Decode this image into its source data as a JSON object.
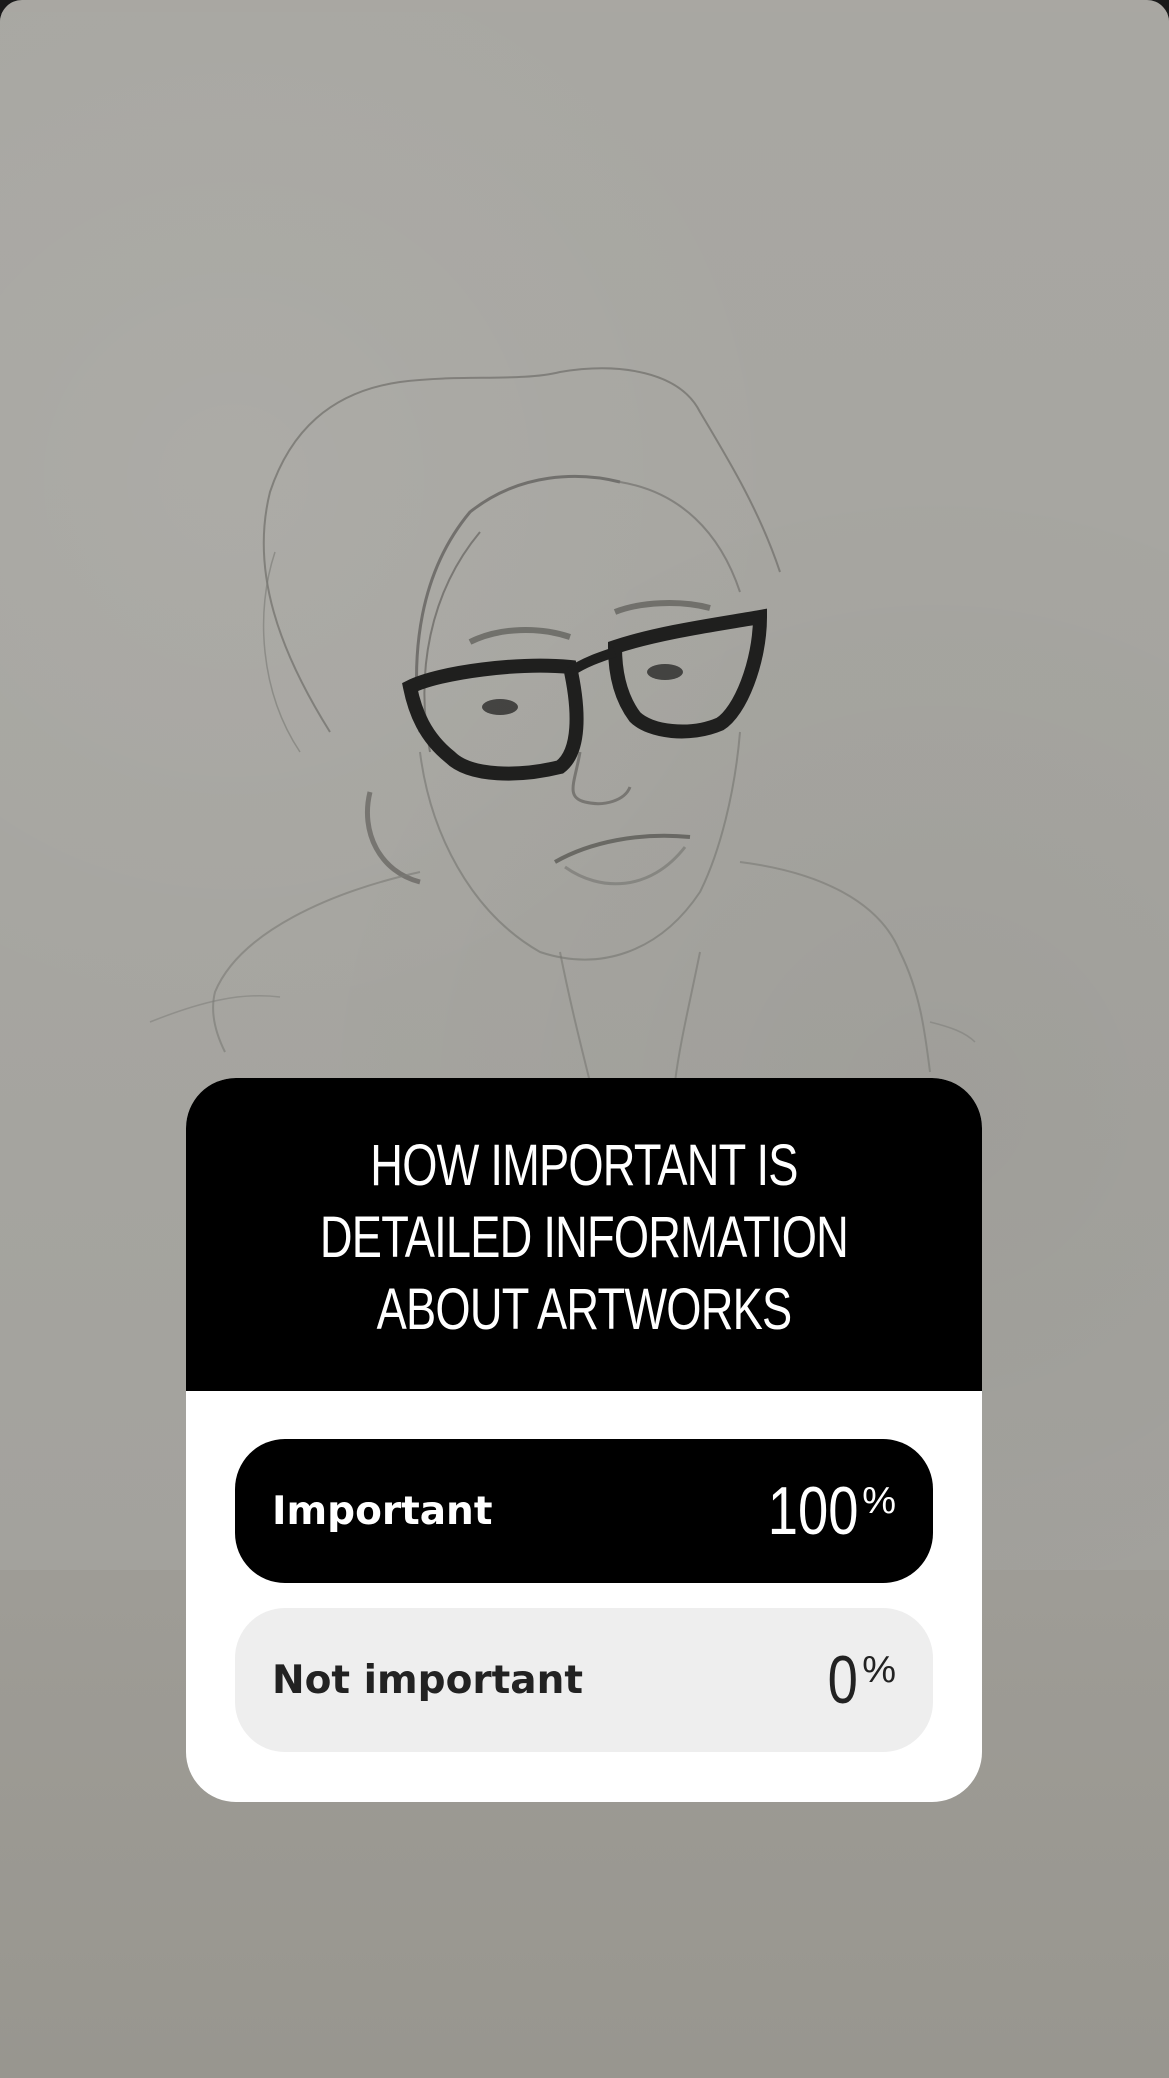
{
  "poll": {
    "question": "HOW IMPORTANT IS DETAILED INFORMATION ABOUT ARTWORKS",
    "options": [
      {
        "label": "Important",
        "percent": "100",
        "percent_sign": "%",
        "share": 1.0
      },
      {
        "label": "Not important",
        "percent": "0",
        "percent_sign": "%",
        "share": 0.0
      }
    ]
  },
  "colors": {
    "header_bg": "#000000",
    "selected_option_bg": "#000000",
    "other_option_bg": "#eeeeee",
    "card_bg": "#ffffff"
  }
}
